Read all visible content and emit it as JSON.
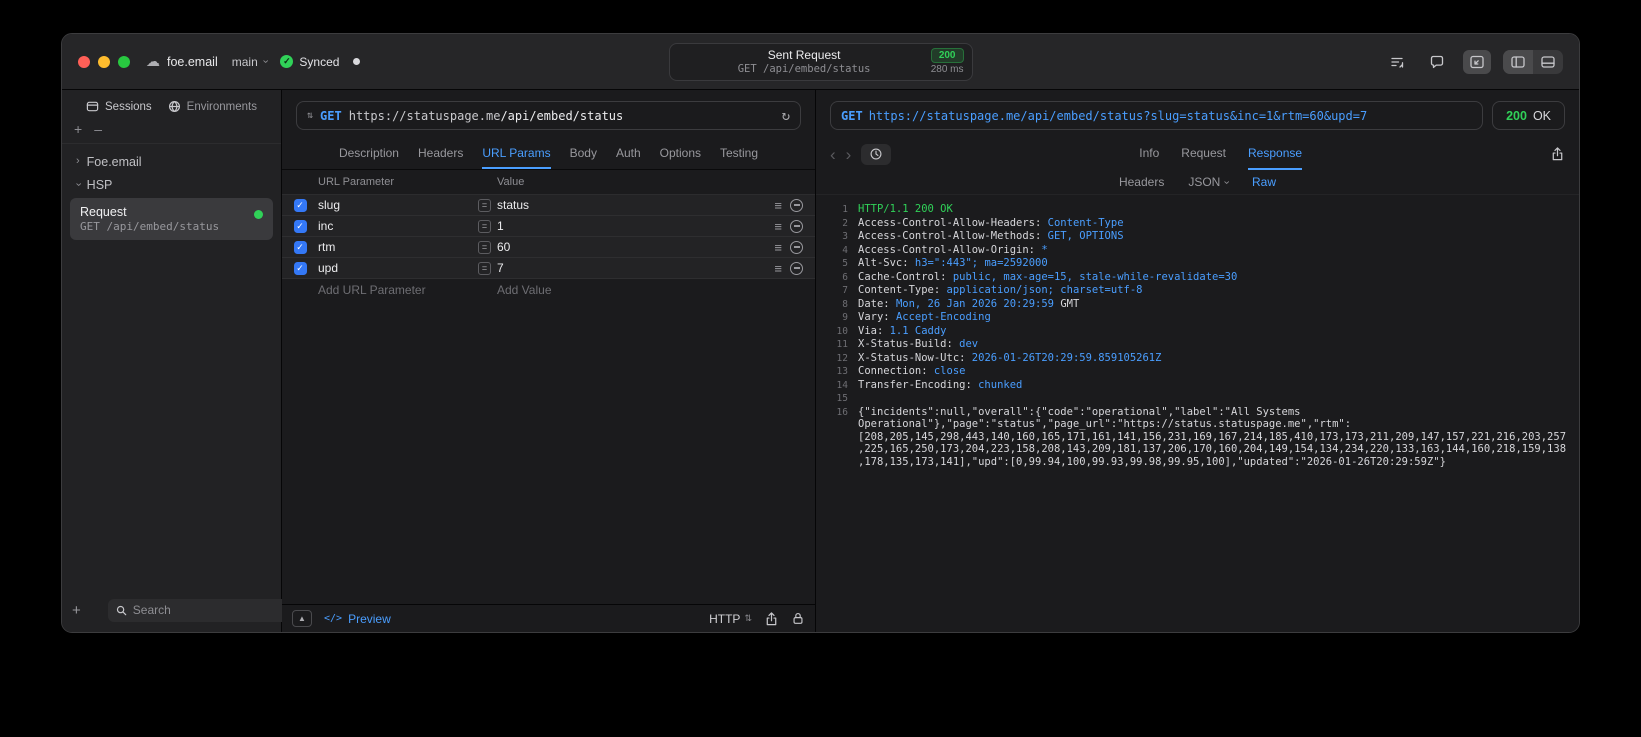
{
  "icons": {
    "cloud": "☁",
    "chevron": "›",
    "refresh": "↻",
    "menu": "≡",
    "method_updown": "⇅",
    "code": "</>",
    "plus": "+",
    "minus": "–",
    "back": "‹",
    "forward": "›",
    "check": "✓",
    "caret_up": "▲"
  },
  "colors": {
    "accent_blue": "#4a9eff",
    "green": "#30d158",
    "status_green": "#32d74b"
  },
  "titlebar": {
    "project": "foe.email",
    "branch": "main",
    "sync_label": "Synced",
    "request_summary": {
      "title": "Sent Request",
      "status_code": "200",
      "method_path": "GET /api/embed/status",
      "duration": "280 ms"
    }
  },
  "sidebar": {
    "tabs": [
      {
        "label": "Sessions"
      },
      {
        "label": "Environments"
      }
    ],
    "tree": [
      {
        "label": "Foe.email"
      },
      {
        "label": "HSP"
      }
    ],
    "selected_request": {
      "title": "Request",
      "subtitle": "GET /api/embed/status"
    },
    "search_placeholder": "Search"
  },
  "request_pane": {
    "method": "GET",
    "url_host": "https://statuspage.me",
    "url_path": "/api/embed/status",
    "tabs": [
      "Description",
      "Headers",
      "URL Params",
      "Body",
      "Auth",
      "Options",
      "Testing"
    ],
    "active_tab": "URL Params",
    "params_table": {
      "columns": [
        "URL Parameter",
        "Value"
      ],
      "rows": [
        {
          "enabled": true,
          "name": "slug",
          "value": "status"
        },
        {
          "enabled": true,
          "name": "inc",
          "value": "1"
        },
        {
          "enabled": true,
          "name": "rtm",
          "value": "60"
        },
        {
          "enabled": true,
          "name": "upd",
          "value": "7"
        }
      ],
      "add_param_placeholder": "Add URL Parameter",
      "add_value_placeholder": "Add Value"
    },
    "footer": {
      "preview_label": "Preview",
      "protocol_label": "HTTP"
    }
  },
  "response_pane": {
    "method": "GET",
    "url": "https://statuspage.me/api/embed/status?slug=status&inc=1&rtm=60&upd=7",
    "status_code": "200",
    "status_text": "OK",
    "tabs": [
      "Info",
      "Request",
      "Response"
    ],
    "active_tab": "Response",
    "subtabs": [
      "Headers",
      "JSON",
      "Raw"
    ],
    "active_subtab": "Raw",
    "lines": [
      {
        "n": "1",
        "segs": [
          {
            "t": "HTTP/1.1 200 OK",
            "c": "green"
          }
        ]
      },
      {
        "n": "2",
        "segs": [
          {
            "t": "Access-Control-Allow-Headers: ",
            "c": "name"
          },
          {
            "t": "Content-Type",
            "c": "val"
          }
        ]
      },
      {
        "n": "3",
        "segs": [
          {
            "t": "Access-Control-Allow-Methods: ",
            "c": "name"
          },
          {
            "t": "GET, OPTIONS",
            "c": "val"
          }
        ]
      },
      {
        "n": "4",
        "segs": [
          {
            "t": "Access-Control-Allow-Origin: ",
            "c": "name"
          },
          {
            "t": "*",
            "c": "val"
          }
        ]
      },
      {
        "n": "5",
        "segs": [
          {
            "t": "Alt-Svc: ",
            "c": "name"
          },
          {
            "t": "h3=\":443\"; ma=2592000",
            "c": "val"
          }
        ]
      },
      {
        "n": "6",
        "segs": [
          {
            "t": "Cache-Control: ",
            "c": "name"
          },
          {
            "t": "public, max-age=15, stale-while-revalidate=30",
            "c": "val"
          }
        ]
      },
      {
        "n": "7",
        "segs": [
          {
            "t": "Content-Type: ",
            "c": "name"
          },
          {
            "t": "application/json; charset=utf-8",
            "c": "val"
          }
        ]
      },
      {
        "n": "8",
        "segs": [
          {
            "t": "Date: ",
            "c": "name"
          },
          {
            "t": "Mon, 26 Jan 2026 20:29:59 ",
            "c": "val"
          },
          {
            "t": "GMT",
            "c": "plain"
          }
        ]
      },
      {
        "n": "9",
        "segs": [
          {
            "t": "Vary: ",
            "c": "name"
          },
          {
            "t": "Accept-Encoding",
            "c": "val"
          }
        ]
      },
      {
        "n": "10",
        "segs": [
          {
            "t": "Via: ",
            "c": "name"
          },
          {
            "t": "1.1 Caddy",
            "c": "val"
          }
        ]
      },
      {
        "n": "11",
        "segs": [
          {
            "t": "X-Status-Build: ",
            "c": "name"
          },
          {
            "t": "dev",
            "c": "val"
          }
        ]
      },
      {
        "n": "12",
        "segs": [
          {
            "t": "X-Status-Now-Utc: ",
            "c": "name"
          },
          {
            "t": "2026-01-26T20:29:59.859105261Z",
            "c": "val"
          }
        ]
      },
      {
        "n": "13",
        "segs": [
          {
            "t": "Connection: ",
            "c": "name"
          },
          {
            "t": "close",
            "c": "val"
          }
        ]
      },
      {
        "n": "14",
        "segs": [
          {
            "t": "Transfer-Encoding: ",
            "c": "name"
          },
          {
            "t": "chunked",
            "c": "val"
          }
        ]
      },
      {
        "n": "15",
        "segs": []
      },
      {
        "n": "16",
        "segs": [
          {
            "t": "{\"incidents\":null,\"overall\":{\"code\":\"operational\",\"label\":\"All Systems Operational\"},\"page\":\"status\",\"page_url\":\"https://status.statuspage.me\",\"rtm\":[208,205,145,298,443,140,160,165,171,161,141,156,231,169,167,214,185,410,173,173,211,209,147,157,221,216,203,257,225,165,250,173,204,223,158,208,143,209,181,137,206,170,160,204,149,154,134,234,220,133,163,144,160,218,159,138,178,135,173,141],\"upd\":[0,99.94,100,99.93,99.98,99.95,100],\"updated\":\"2026-01-26T20:29:59Z\"}",
            "c": "plain"
          }
        ]
      }
    ]
  }
}
